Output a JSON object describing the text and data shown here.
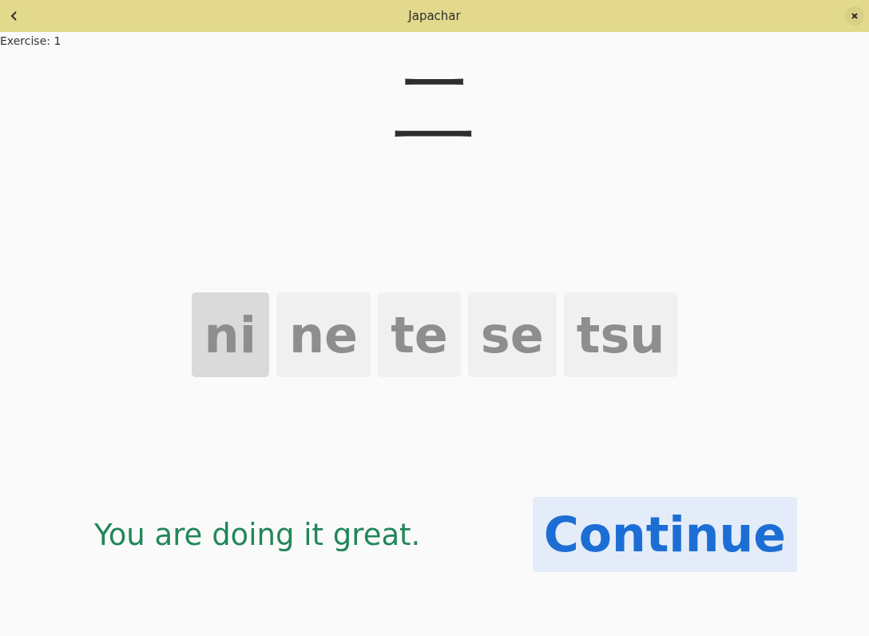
{
  "window": {
    "title": "Japachar"
  },
  "exercise_label": "Exercise: 1",
  "character": "二",
  "options": [
    {
      "label": "ni",
      "selected": true
    },
    {
      "label": "ne",
      "selected": false
    },
    {
      "label": "te",
      "selected": false
    },
    {
      "label": "se",
      "selected": false
    },
    {
      "label": "tsu",
      "selected": false
    }
  ],
  "feedback": "You are doing it great.",
  "continue_button": "Continue"
}
